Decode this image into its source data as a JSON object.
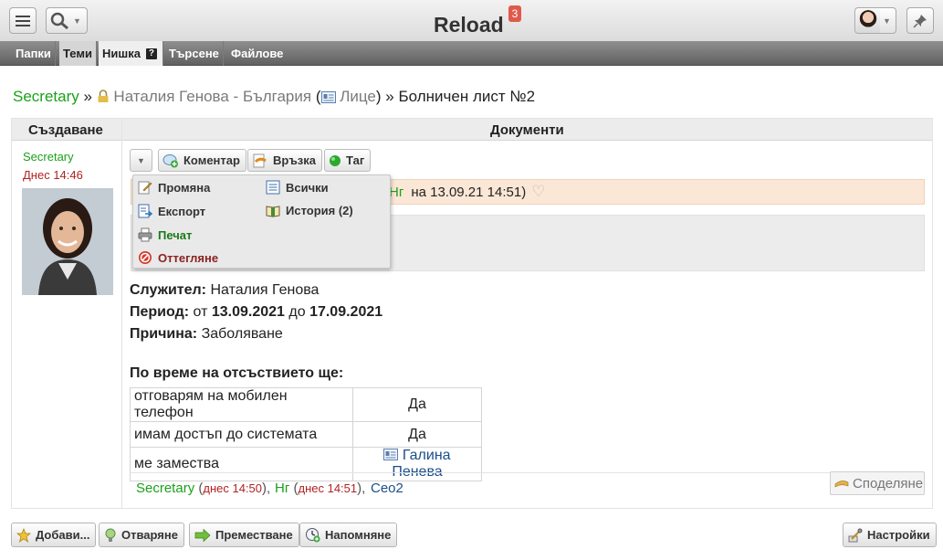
{
  "app": {
    "title": "Reload",
    "notification_count": "3"
  },
  "tabs": [
    {
      "label": "Папки"
    },
    {
      "label": "Теми"
    },
    {
      "label": "Нишка"
    },
    {
      "label": "Търсене"
    },
    {
      "label": "Файлове"
    }
  ],
  "tab_help": "?",
  "breadcrumb": {
    "root": "Secretary",
    "sep1": "»",
    "folder": "Наталия Генова - България",
    "open_paren": "(",
    "type": "Лице",
    "close_paren": ")",
    "sep2": "»",
    "current": "Болничен лист №2"
  },
  "columns": {
    "author": "Създаване",
    "content": "Документи"
  },
  "sidebar": {
    "author": "Secretary",
    "date": "Днес 14:46"
  },
  "toolbar": {
    "comment": "Коментар",
    "link": "Връзка",
    "tag": "Таг"
  },
  "menu": {
    "edit": "Промяна",
    "all": "Всички",
    "export": "Експорт",
    "history": "История (2)",
    "print": "Печат",
    "withdraw": "Оттегляне"
  },
  "message": {
    "author": "Нг",
    "on_text": "на 13.09.21 14:51)"
  },
  "document": {
    "employee_label": "Служител:",
    "employee_value": "Наталия Генова",
    "period_label": "Период:",
    "period_from_word": "от",
    "period_from": "13.09.2021",
    "period_to_word": "до",
    "period_to": "17.09.2021",
    "reason_label": "Причина:",
    "reason_value": "Заболяване",
    "absence_title": "По време на отсъствието ще:",
    "rows": [
      {
        "q": "отговарям на мобилен телефон",
        "a": "Да"
      },
      {
        "q": "имам достъп до системата",
        "a": "Да"
      },
      {
        "q": "ме замества",
        "a": "Галина Пенева"
      }
    ]
  },
  "readers": [
    {
      "name": "Secretary",
      "date": "днес 14:50"
    },
    {
      "name": "Нг",
      "date": "днес 14:51"
    },
    {
      "name": "Ceo2"
    }
  ],
  "share_label": "Споделяне",
  "bottom": {
    "add": "Добави...",
    "open": "Отваряне",
    "move": "Преместване",
    "remind": "Напомняне",
    "settings": "Настройки"
  }
}
